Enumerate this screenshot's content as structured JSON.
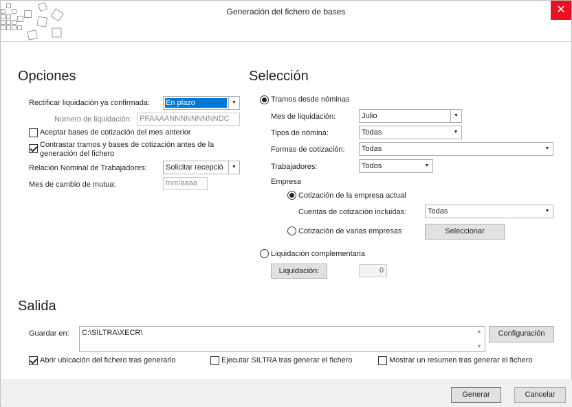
{
  "window": {
    "title": "Generación del fichero de bases",
    "close_glyph": "✕"
  },
  "opciones": {
    "heading": "Opciones",
    "rectificar_label": "Rectificar liquidación ya confirmada:",
    "rectificar_value": "En plazo",
    "numero_label": "Número de liquidación:",
    "numero_placeholder": "PPAAAANNNNNNNNNDC",
    "aceptar_label": "Aceptar bases de cotización del mes anterior",
    "aceptar_checked": false,
    "contrastar_label_1": "Contrastar tramos y bases de cotización antes de la",
    "contrastar_label_2": "generación del fichero",
    "contrastar_checked": true,
    "relacion_label": "Relación Nominal de Trabajadores:",
    "relacion_value": "Solicitar recepció",
    "mes_cambio_label": "Mes de cambio de mutua:",
    "mes_cambio_placeholder": "mm/aaaa"
  },
  "seleccion": {
    "heading": "Selección",
    "tramos_label": "Tramos desde nóminas",
    "tramos_selected": true,
    "mes_label": "Mes de liquidación:",
    "mes_value": "Julio",
    "tipos_label": "Tipos de nómina:",
    "tipos_value": "Todas",
    "formas_label": "Formas de cotización:",
    "formas_value": "Todas",
    "trabajadores_label": "Trabajadores:",
    "trabajadores_value": "Todos",
    "empresa_label": "Empresa",
    "cot_actual_label": "Cotización de la empresa actual",
    "cot_actual_selected": true,
    "cuentas_label": "Cuentas de cotización incluidas:",
    "cuentas_value": "Todas",
    "cot_varias_label": "Cotización de varias empresas",
    "cot_varias_selected": false,
    "seleccionar_button": "Seleccionar",
    "complementaria_label": "Liquidación complementaria",
    "complementaria_selected": false,
    "liquidacion_button": "Liquidación:",
    "liquidacion_value": "0"
  },
  "salida": {
    "heading": "Salida",
    "guardar_label": "Guardar en:",
    "guardar_value": "C:\\SILTRA\\XECR\\",
    "configuracion_button": "Configuración",
    "abrir_label": "Abrir ubicación del fichero tras generarlo",
    "abrir_checked": true,
    "ejecutar_label": "Ejecutar SILTRA tras generar el fichero",
    "ejecutar_checked": false,
    "mostrar_label": "Mostrar un resumen tras generar el fichero",
    "mostrar_checked": false
  },
  "footer": {
    "generar_button": "Generar",
    "cancelar_button": "Cancelar"
  },
  "icons": {
    "dropdown": "chevron-down-icon",
    "close": "close-icon",
    "logo": "app-logo"
  },
  "colors": {
    "close_bg": "#e81123",
    "selection": "#0078d7"
  }
}
